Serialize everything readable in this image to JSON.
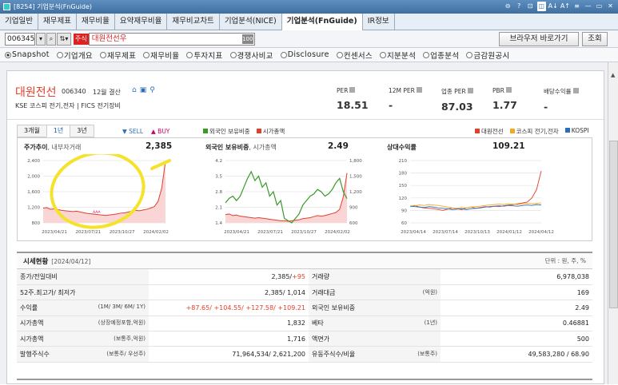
{
  "window": {
    "title": "[8254] 기업분석(FnGuide)",
    "controls": [
      "⊖",
      "?",
      "⊡",
      "◫",
      "A↓",
      "A↑",
      "≡",
      "—",
      "▭",
      "✕"
    ]
  },
  "tabs": [
    "기업일반",
    "재무제표",
    "재무비율",
    "요약재무비율",
    "재무비교차트",
    "기업분석(NICE)",
    "기업분석(FnGuide)",
    "IR정보"
  ],
  "toolbar": {
    "code": "006345",
    "badge": "주식",
    "name": "대원전선우",
    "num_label": "100",
    "browser_button": "브라우저 바로가기",
    "query_button": "조회"
  },
  "radios": [
    {
      "label": "Snapshot",
      "on": true
    },
    {
      "label": "기업개요",
      "on": false
    },
    {
      "label": "재무제표",
      "on": false
    },
    {
      "label": "재무비율",
      "on": false
    },
    {
      "label": "투자지표",
      "on": false
    },
    {
      "label": "경쟁사비교",
      "on": false
    },
    {
      "label": "Disclosure",
      "on": false
    },
    {
      "label": "컨센서스",
      "on": false
    },
    {
      "label": "지분분석",
      "on": false
    },
    {
      "label": "업종분석",
      "on": false
    },
    {
      "label": "금감원공시",
      "on": false
    }
  ],
  "company": {
    "name": "대원전선",
    "code": "006340",
    "settle": "12월 결산",
    "sector": "KSE  코스피 전기,전자   |   FICS 전기장비"
  },
  "metrics": [
    {
      "label": "PER",
      "value": "18.51"
    },
    {
      "label": "12M PER",
      "value": "-"
    },
    {
      "label": "업종 PER",
      "value": "87.03"
    },
    {
      "label": "PBR",
      "value": "1.77"
    },
    {
      "label": "배당수익률",
      "value": "-"
    }
  ],
  "chart_tabs": [
    "3개월",
    "1년",
    "3년"
  ],
  "sell": "▼ SELL",
  "buy": "▲ BUY",
  "legend_mid": [
    {
      "name": "외국인 보유비중",
      "color": "#3a9a2a"
    },
    {
      "name": "시가총액",
      "color": "#e2402a"
    }
  ],
  "legend_right": [
    {
      "name": "대원전선",
      "color": "#e2402a"
    },
    {
      "name": "코스피 전기,전자",
      "color": "#f5a623"
    },
    {
      "name": "KOSPI",
      "color": "#2a6ebb"
    }
  ],
  "chart_data": [
    {
      "type": "area",
      "title": "주가추이",
      "subtitle": ", 내부자거래",
      "value": "2,385",
      "ylim": [
        800,
        2400
      ],
      "yticks": [
        "2,400",
        "2,000",
        "1,600",
        "1,200",
        "800"
      ],
      "xticks": [
        "2023/04/21",
        "2023/07/21",
        "2023/10/27",
        "2024/02/02"
      ],
      "series": [
        {
          "values": [
            1180,
            1190,
            1150,
            1160,
            1140,
            1120,
            1110,
            1100,
            1090,
            1100,
            1080,
            1060,
            1040,
            1030,
            1020,
            1010,
            1000,
            990,
            1005,
            1015,
            1030,
            1050,
            1060,
            1080,
            1100,
            1120,
            1110,
            1130,
            1150,
            1180,
            1220,
            1350,
            1700,
            2385
          ]
        }
      ],
      "annotation": "AAA"
    },
    {
      "type": "line",
      "title": "외국인 보유비중",
      "subtitle": ", 시가총액",
      "value": "2.49",
      "ylim_left": [
        1.4,
        4.2
      ],
      "yticks_left": [
        "4.2",
        "3.5",
        "2.8",
        "2.1",
        "1.4"
      ],
      "ylim_right": [
        600,
        1800
      ],
      "yticks_right": [
        "1,800",
        "1,500",
        "1,200",
        "900",
        "600"
      ],
      "xticks": [
        "2023/04/21",
        "2023/07/21",
        "2023/10/27",
        "2024/02/02"
      ],
      "series": [
        {
          "name": "외국인 보유비중",
          "values": [
            2.3,
            2.5,
            2.6,
            2.4,
            2.6,
            3.0,
            3.4,
            3.7,
            3.3,
            3.5,
            3.0,
            3.2,
            2.6,
            2.8,
            2.2,
            2.4,
            1.6,
            1.5,
            1.4,
            1.6,
            1.8,
            2.2,
            2.4,
            2.6,
            2.7,
            2.9,
            2.8,
            2.6,
            2.7,
            2.9,
            3.2,
            3.4,
            2.8,
            2.49
          ]
        },
        {
          "name": "시가총액",
          "values": [
            760,
            770,
            740,
            750,
            730,
            720,
            710,
            700,
            690,
            700,
            690,
            680,
            670,
            660,
            650,
            640,
            640,
            630,
            640,
            650,
            660,
            680,
            690,
            700,
            720,
            740,
            730,
            740,
            760,
            780,
            800,
            860,
            1100,
            1560
          ]
        }
      ]
    },
    {
      "type": "line",
      "title": "상대수익률",
      "value": "109.21",
      "ylim": [
        60,
        210
      ],
      "yticks": [
        "210",
        "180",
        "150",
        "120",
        "90",
        "60"
      ],
      "xticks": [
        "2023/04/14",
        "2023/07/14",
        "2023/10/13",
        "2024/01/12",
        "2024/04/12"
      ],
      "series": [
        {
          "name": "대원전선",
          "values": [
            100,
            102,
            98,
            96,
            95,
            94,
            92,
            90,
            93,
            96,
            94,
            92,
            96,
            98,
            95,
            97,
            99,
            98,
            100,
            99,
            101,
            103,
            104,
            106,
            108,
            110,
            120,
            140,
            185
          ]
        },
        {
          "name": "코스피 전기,전자",
          "values": [
            100,
            101,
            103,
            102,
            104,
            103,
            102,
            100,
            98,
            96,
            95,
            97,
            96,
            98,
            99,
            100,
            102,
            103,
            104,
            105,
            104,
            106,
            105,
            104,
            106,
            107,
            106,
            107,
            108
          ]
        },
        {
          "name": "KOSPI",
          "values": [
            100,
            99,
            98,
            97,
            99,
            98,
            96,
            95,
            94,
            92,
            93,
            94,
            92,
            94,
            95,
            96,
            98,
            99,
            100,
            101,
            100,
            102,
            101,
            100,
            102,
            103,
            102,
            104,
            103
          ]
        }
      ]
    }
  ],
  "table": {
    "title": "시세현황",
    "date": "[2024/04/12]",
    "unit": "단위 : 원, 주, %",
    "rows": [
      {
        "l1": "종가/전일대비",
        "s1": "",
        "v1": "2,385/",
        "v1r": "+95",
        "l2": "거래량",
        "s2": "",
        "v2": "6,978,038"
      },
      {
        "l1": "52주.최고가/ 최저가",
        "s1": "",
        "v1": "2,385/ 1,014",
        "v1r": "",
        "l2": "거래대금",
        "s2": "(억원)",
        "v2": "169"
      },
      {
        "l1": "수익률",
        "s1": "(1M/ 3M/ 6M/ 1Y)",
        "v1": "",
        "v1r": "+87.65/ +104.55/ +127.58/ +109.21",
        "l2": "외국인 보유비중",
        "s2": "",
        "v2": "2.49"
      },
      {
        "l1": "시가총액",
        "s1": "(상장예정포함,억원)",
        "v1": "1,832",
        "v1r": "",
        "l2": "베타",
        "s2": "(1년)",
        "v2": "0.46881"
      },
      {
        "l1": "시가총액",
        "s1": "(보통주,억원)",
        "v1": "1,716",
        "v1r": "",
        "l2": "액면가",
        "s2": "",
        "v2": "500"
      },
      {
        "l1": "발행주식수",
        "s1": "(보통주/ 우선주)",
        "v1": "71,964,534/ 2,621,200",
        "v1r": "",
        "l2": "유동주식수/비율",
        "s2": "(보통주)",
        "v2": "49,583,280 / 68.90"
      }
    ]
  }
}
